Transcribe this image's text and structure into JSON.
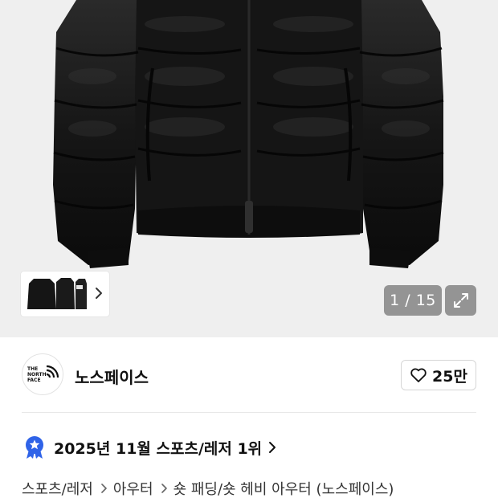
{
  "gallery": {
    "counter": "1 / 15",
    "current": 1,
    "total": 15
  },
  "brand": {
    "name": "노스페이스",
    "logo_text_line1": "THE",
    "logo_text_line2": "NORTH",
    "logo_text_line3": "FACE"
  },
  "like": {
    "count": "25만"
  },
  "ranking": {
    "text": "2025년 11월 스포츠/레저 1위"
  },
  "breadcrumb": {
    "items": [
      "스포츠/레저",
      "아우터",
      "숏 패딩/숏 헤비 아우터 (노스페이스)"
    ]
  },
  "colors": {
    "accent_blue": "#2f63e8",
    "jacket": "#141414",
    "background": "#efefef"
  }
}
